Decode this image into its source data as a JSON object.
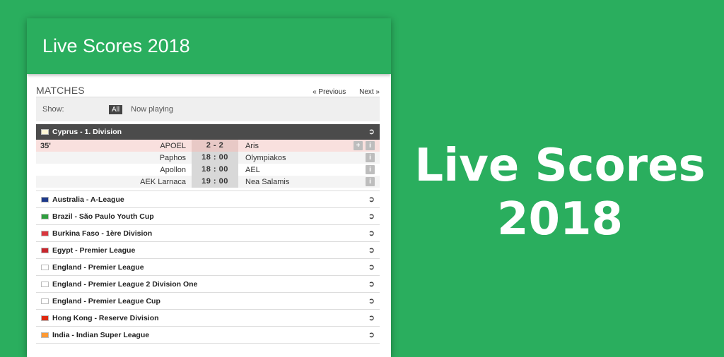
{
  "app": {
    "title": "Live Scores 2018"
  },
  "matches_header": {
    "title": "MATCHES",
    "prev": "« Previous",
    "next": "Next »"
  },
  "show": {
    "label": "Show:",
    "all": "All",
    "now_playing": "Now playing"
  },
  "open_league": {
    "name": "Cyprus - 1. Division",
    "matches": [
      {
        "minute": "35'",
        "home": "APOEL",
        "score": "2 - 2",
        "away": "Aris"
      },
      {
        "minute": "",
        "home": "Paphos",
        "score": "18 : 00",
        "away": "Olympiakos"
      },
      {
        "minute": "",
        "home": "Apollon",
        "score": "18 : 00",
        "away": "AEL"
      },
      {
        "minute": "",
        "home": "AEK Larnaca",
        "score": "19 : 00",
        "away": "Nea Salamis"
      }
    ]
  },
  "leagues": [
    {
      "name": "Australia - A-League",
      "flag": "#1e3a8a"
    },
    {
      "name": "Brazil - São Paulo Youth Cup",
      "flag": "#2e9e3e"
    },
    {
      "name": "Burkina Faso - 1ère Division",
      "flag": "#d9363e"
    },
    {
      "name": "Egypt - Premier League",
      "flag": "#c8262d"
    },
    {
      "name": "England - Premier League",
      "flag": "#ffffff"
    },
    {
      "name": "England - Premier League 2 Division One",
      "flag": "#ffffff"
    },
    {
      "name": "England - Premier League Cup",
      "flag": "#ffffff"
    },
    {
      "name": "Hong Kong - Reserve Division",
      "flag": "#de2910"
    },
    {
      "name": "India - Indian Super League",
      "flag": "#ff9933"
    }
  ],
  "hero": {
    "line1": "Live Scores",
    "line2": "2018"
  },
  "icons": {
    "plus": "+",
    "info": "i",
    "arrow": "➲"
  }
}
